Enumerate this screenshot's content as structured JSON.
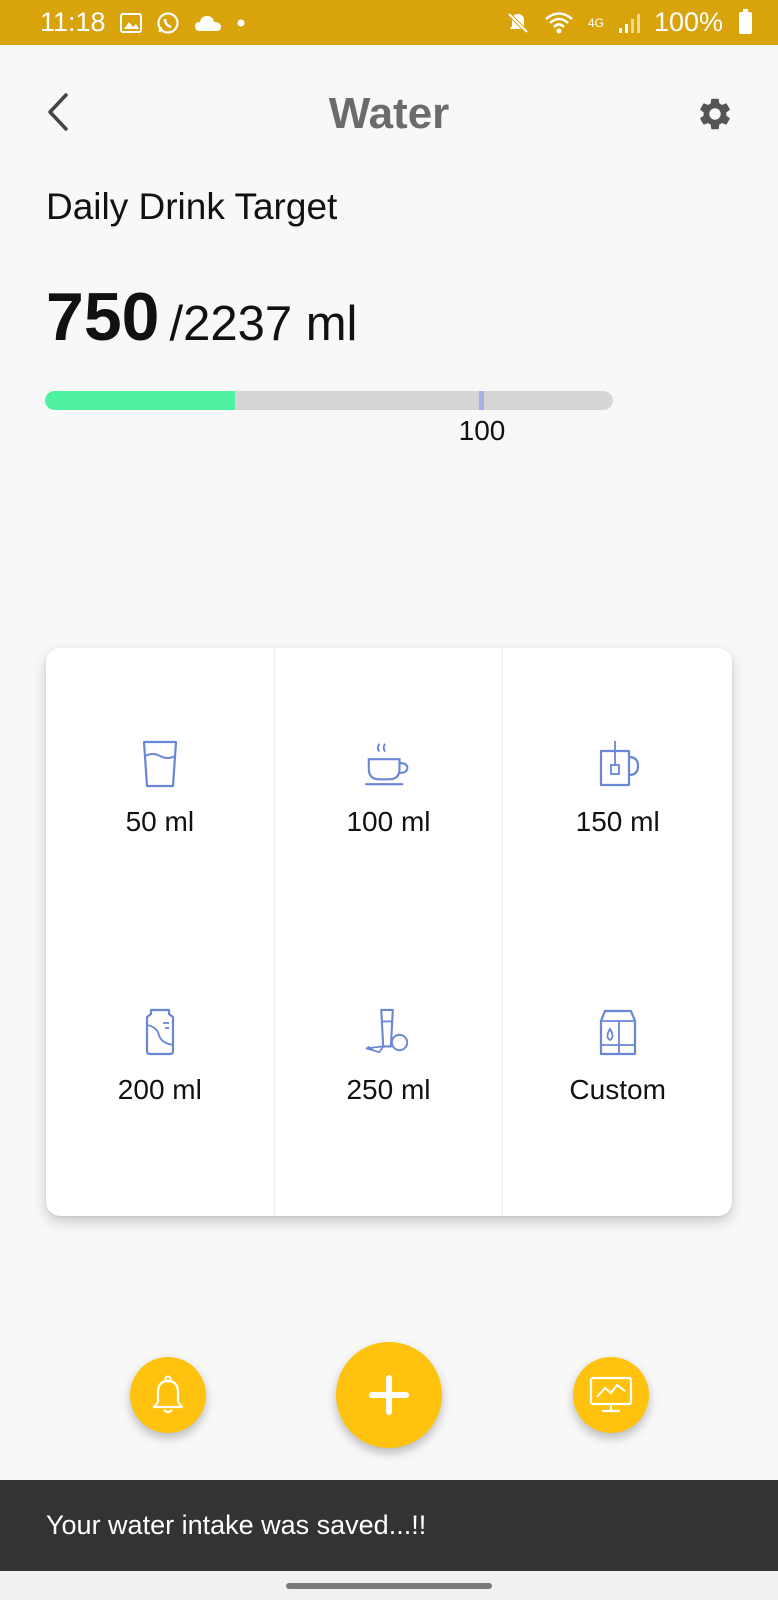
{
  "status_bar": {
    "time": "11:18",
    "network": "4G",
    "battery": "100%",
    "icons": [
      "gallery-icon",
      "whatsapp-icon",
      "cloud-icon",
      "dot-icon",
      "mute-icon",
      "wifi-icon",
      "signal-icon",
      "battery-icon"
    ]
  },
  "header": {
    "title": "Water",
    "back_icon": "chevron-left-icon",
    "settings_icon": "gear-icon"
  },
  "target": {
    "label": "Daily Drink Target",
    "current": "750",
    "total": "/2237 ml",
    "progress_fraction": 0.335,
    "marker_label": "100",
    "marker_fraction": 0.847
  },
  "cups": [
    {
      "label": "50 ml",
      "icon": "glass-icon"
    },
    {
      "label": "100 ml",
      "icon": "coffee-cup-icon"
    },
    {
      "label": "150 ml",
      "icon": "tea-mug-icon"
    },
    {
      "label": "200 ml",
      "icon": "soda-can-icon"
    },
    {
      "label": "250 ml",
      "icon": "juice-icon"
    },
    {
      "label": "Custom",
      "icon": "milk-carton-icon"
    }
  ],
  "actions": {
    "reminder_icon": "bell-icon",
    "add_icon": "plus-icon",
    "stats_icon": "chart-monitor-icon"
  },
  "snackbar": {
    "message": "Your water intake was saved...!!"
  },
  "colors": {
    "status_bar": "#d8a30b",
    "accent": "#ffc20e",
    "progress": "#4ef2a1",
    "marker": "#a9afe8",
    "icon_stroke": "#6a86d6"
  }
}
